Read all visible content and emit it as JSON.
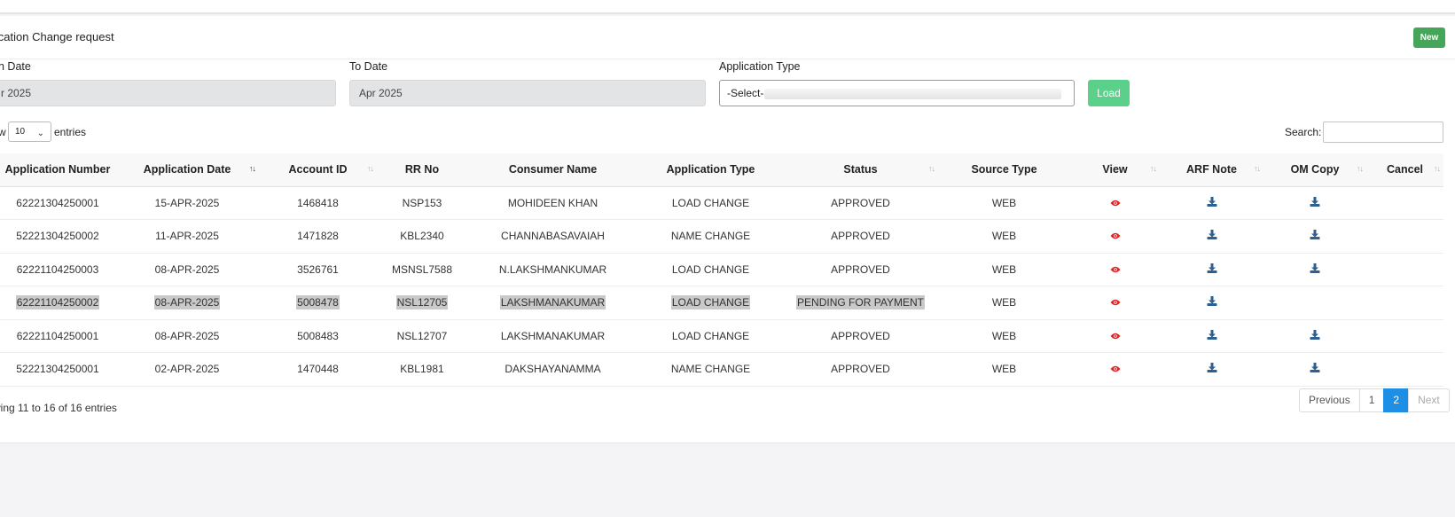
{
  "header": {
    "title": "lication Change request",
    "new_label": "New"
  },
  "filters": {
    "from_label": "n Date",
    "from_value": "r 2025",
    "to_label": "To Date",
    "to_value": "Apr 2025",
    "type_label": "Application Type",
    "type_value": "-Select-",
    "load_label": "Load"
  },
  "controls": {
    "show_label": "w",
    "entries_value": "10",
    "entries_label": "entries",
    "search_label": "Search:"
  },
  "columns": [
    "Application Number",
    "Application Date",
    "Account ID",
    "RR No",
    "Consumer Name",
    "Application Type",
    "Status",
    "Source Type",
    "View",
    "ARF Note",
    "OM Copy",
    "Cancel"
  ],
  "rows": [
    {
      "app_no": "62221304250001",
      "date": "15-APR-2025",
      "account": "1468418",
      "rr": "NSP153",
      "name": "MOHIDEEN KHAN",
      "type": "LOAD CHANGE",
      "status": "APPROVED",
      "source": "WEB",
      "om": true
    },
    {
      "app_no": "52221304250002",
      "date": "11-APR-2025",
      "account": "1471828",
      "rr": "KBL2340",
      "name": "CHANNABASAVAIAH",
      "type": "NAME CHANGE",
      "status": "APPROVED",
      "source": "WEB",
      "om": true
    },
    {
      "app_no": "62221104250003",
      "date": "08-APR-2025",
      "account": "3526761",
      "rr": "MSNSL7588",
      "name": "N.LAKSHMANKUMAR",
      "type": "LOAD CHANGE",
      "status": "APPROVED",
      "source": "WEB",
      "om": true
    },
    {
      "app_no": "62221104250002",
      "date": "08-APR-2025",
      "account": "5008478",
      "rr": "NSL12705",
      "name": "LAKSHMANAKUMAR",
      "type": "LOAD CHANGE",
      "status": "PENDING FOR PAYMENT",
      "source": "WEB",
      "om": false,
      "highlight": true
    },
    {
      "app_no": "62221104250001",
      "date": "08-APR-2025",
      "account": "5008483",
      "rr": "NSL12707",
      "name": "LAKSHMANAKUMAR",
      "type": "LOAD CHANGE",
      "status": "APPROVED",
      "source": "WEB",
      "om": true
    },
    {
      "app_no": "52221304250001",
      "date": "02-APR-2025",
      "account": "1470448",
      "rr": "KBL1981",
      "name": "DAKSHAYANAMMA",
      "type": "NAME CHANGE",
      "status": "APPROVED",
      "source": "WEB",
      "om": true
    }
  ],
  "footer": {
    "info": "wing 11 to 16 of 16 entries",
    "previous": "Previous",
    "page1": "1",
    "page2": "2",
    "next": "Next"
  },
  "colors": {
    "new_button": "#45a65a",
    "load_button": "#5ad08a",
    "active_page": "#1f8fe5",
    "view_icon": "#e02424",
    "download_icon": "#2d5f8f"
  },
  "icons": {
    "view": "eye-icon",
    "arf_note": "download-icon",
    "om_copy": "download-icon",
    "select": "chevron-down-icon"
  }
}
